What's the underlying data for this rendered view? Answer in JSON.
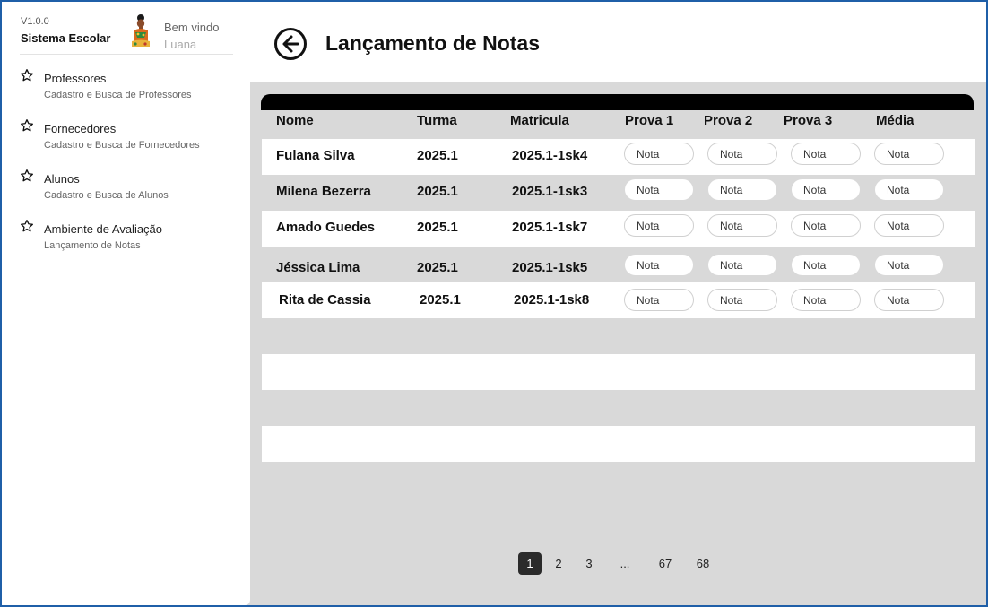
{
  "sidebar": {
    "version": "V1.0.0",
    "app_name": "Sistema Escolar",
    "welcome": "Bem vindo",
    "user_name": "Luana",
    "items": [
      {
        "label": "Professores",
        "sub": "Cadastro e Busca de Professores",
        "icon": "star-icon"
      },
      {
        "label": "Fornecedores",
        "sub": "Cadastro e Busca de Fornecedores",
        "icon": "star-icon"
      },
      {
        "label": "Alunos",
        "sub": "Cadastro e Busca de Alunos",
        "icon": "star-icon"
      },
      {
        "label": "Ambiente de Avaliação",
        "sub": "Lançamento de Notas",
        "icon": "star-icon"
      }
    ]
  },
  "header": {
    "title": "Lançamento de Notas",
    "back_icon": "arrow-left-circle-icon"
  },
  "table": {
    "columns": [
      "Nome",
      "Turma",
      "Matricula",
      "Prova 1",
      "Prova 2",
      "Prova 3",
      "Média"
    ],
    "input_placeholder": "Nota",
    "rows": [
      {
        "nome": "Fulana Silva",
        "turma": "2025.1",
        "matricula": "2025.1-1sk4"
      },
      {
        "nome": "Milena Bezerra",
        "turma": "2025.1",
        "matricula": "2025.1-1sk3"
      },
      {
        "nome": "Amado Guedes",
        "turma": "2025.1",
        "matricula": "2025.1-1sk7"
      },
      {
        "nome": "Jéssica Lima",
        "turma": "2025.1",
        "matricula": "2025.1-1sk5"
      },
      {
        "nome": "Rita de Cassia",
        "turma": "2025.1",
        "matricula": "2025.1-1sk8"
      }
    ]
  },
  "pagination": {
    "pages": [
      "1",
      "2",
      "3",
      "...",
      "67",
      "68"
    ],
    "current": "1"
  },
  "colors": {
    "accent_border": "#1f5fa8",
    "background": "#d9d9d9",
    "active_page": "#2b2b2b"
  }
}
